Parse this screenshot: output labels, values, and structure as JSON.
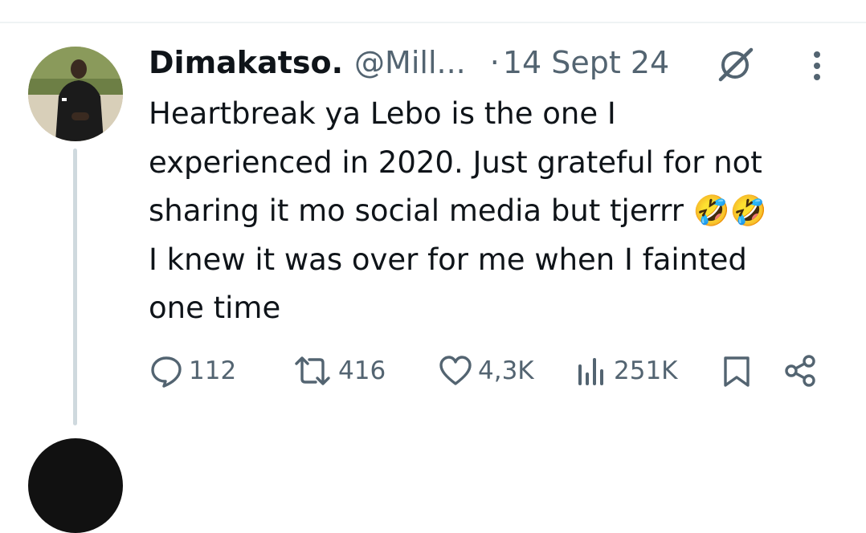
{
  "tweet": {
    "author": {
      "display_name": "Dimakatso.",
      "handle": "@Mill...",
      "avatar_icon": "profile-photo"
    },
    "separator": "·",
    "date": "14 Sept 24",
    "text": "Heartbreak ya Lebo is the one I\nexperienced in 2020. Just grateful for not\nsharing it mo social media but tjerrr 🤣🤣\nI knew it was over for me when I fainted\none time",
    "icons": {
      "grok": "grok-icon",
      "more": "more-options-icon"
    },
    "actions": {
      "replies": {
        "icon": "reply-icon",
        "count": "112"
      },
      "reposts": {
        "icon": "repost-icon",
        "count": "416"
      },
      "likes": {
        "icon": "like-icon",
        "count": "4,3K"
      },
      "views": {
        "icon": "views-icon",
        "count": "251K"
      },
      "bookmark": {
        "icon": "bookmark-icon"
      },
      "share": {
        "icon": "share-icon"
      }
    }
  },
  "colors": {
    "text_primary": "#0f1419",
    "text_secondary": "#536471",
    "thread_line": "#cfd9de",
    "divider": "#eff3f4"
  }
}
